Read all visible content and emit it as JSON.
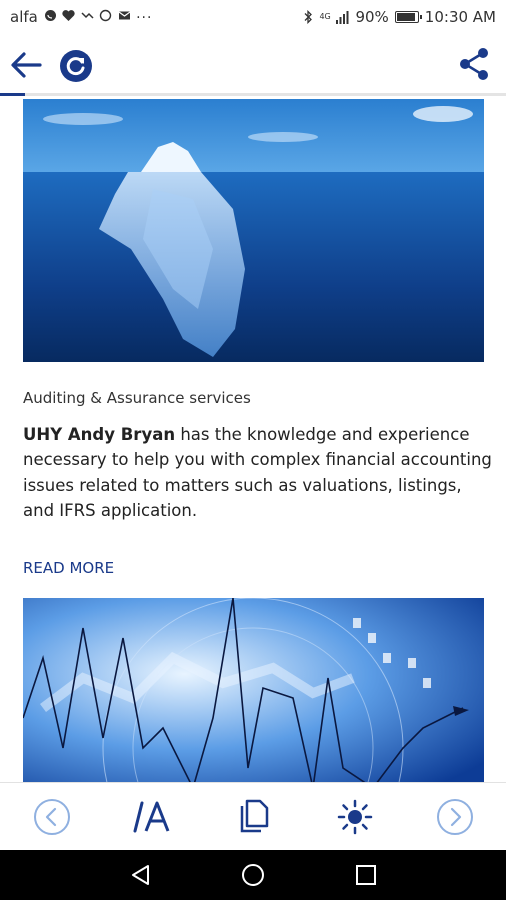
{
  "status_bar": {
    "carrier": "alfa",
    "notification_icons": [
      "whatsapp-icon",
      "heart-monitor-icon",
      "missed-call-icon",
      "whatsapp-icon",
      "gmail-icon",
      "more-icon"
    ],
    "more_indicator": "···",
    "signal_tech": "4G",
    "battery": "90%",
    "time": "10:30 AM"
  },
  "app_bar": {
    "back_icon": "arrow-left-icon",
    "refresh_icon": "refresh-icon",
    "share_icon": "share-icon",
    "page_load_progress": 0.05
  },
  "article": {
    "title": "Auditing & Assurance services",
    "company": "UHY Andy Bryan",
    "body": " has the knowledge and experience necessary to help you with complex financial accounting issues related to matters such as valuations, listings, and IFRS application.",
    "read_more": "READ MORE"
  },
  "bottom_toolbar": {
    "items": [
      "back-circle-icon",
      "text-size-icon",
      "copy-document-icon",
      "brightness-icon",
      "forward-circle-icon"
    ]
  },
  "system_nav": {
    "items": [
      "back-triangle-icon",
      "home-circle-icon",
      "recents-square-icon"
    ]
  },
  "colors": {
    "accent": "#1a3a8a",
    "icon_light": "#8fb0e0",
    "icon_dark": "#1a3a8a"
  }
}
